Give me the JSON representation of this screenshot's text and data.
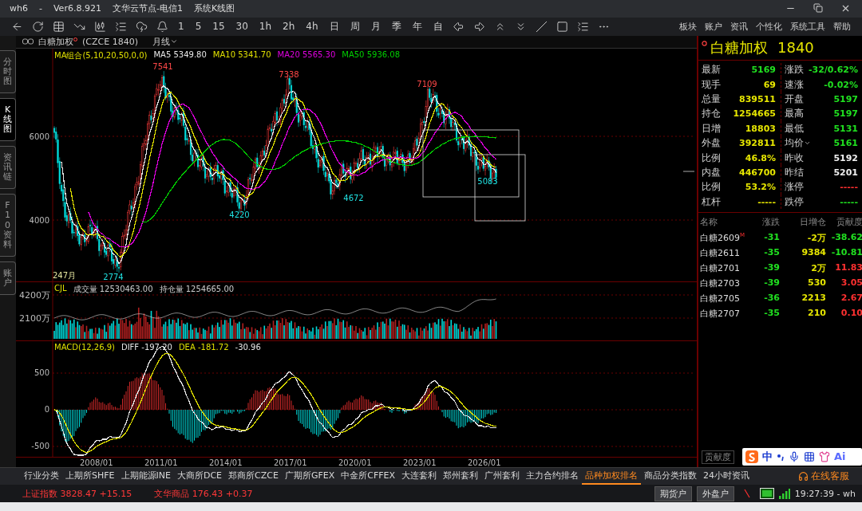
{
  "title_bar": {
    "items": [
      "wh6",
      "-",
      "Ver6.8.921",
      "文华云节点-电信1",
      "系统K线图"
    ]
  },
  "toolbar": {
    "periods": [
      "1",
      "5",
      "15",
      "30",
      "1h",
      "2h",
      "4h",
      "日",
      "周",
      "月",
      "季",
      "年",
      "自"
    ],
    "menus": [
      "板块",
      "账户",
      "资讯",
      "个性化",
      "系统工具",
      "帮助"
    ]
  },
  "side_tabs": [
    {
      "label": "分时图",
      "selected": false
    },
    {
      "label": "K线图",
      "selected": true
    },
    {
      "label": "资讯链",
      "selected": false
    },
    {
      "label": "F10资料",
      "selected": false
    },
    {
      "label": "账户",
      "selected": false
    }
  ],
  "chart": {
    "symbol": "白糖加权",
    "code": "(CZCE 1840)",
    "period": "月线",
    "ma_legend": "MA组合(5,10,20,50,0,0)",
    "ma": [
      {
        "label": "MA5 5349.80",
        "color": "#e8e8e8"
      },
      {
        "label": "MA10 5341.70",
        "color": "#e0e000"
      },
      {
        "label": "MA20 5565.30",
        "color": "#e000e0"
      },
      {
        "label": "MA50 5936.08",
        "color": "#00d000"
      }
    ],
    "price_axis": [
      "6000",
      "4000"
    ],
    "extremes": [
      {
        "text": "7541",
        "kind": "high"
      },
      {
        "text": "7338",
        "kind": "high"
      },
      {
        "text": "7109",
        "kind": "high"
      },
      {
        "text": "4220",
        "kind": "low"
      },
      {
        "text": "4672",
        "kind": "low"
      },
      {
        "text": "5083",
        "kind": "low"
      },
      {
        "text": "2774",
        "kind": "low"
      }
    ],
    "bar_count": "247月",
    "volume": {
      "name": "CJL",
      "items": [
        "成交量 12530463.00",
        "持仓量 1254665.00"
      ],
      "axis": [
        "4200万",
        "2100万"
      ]
    },
    "macd": {
      "name": "MACD(12,26,9)",
      "items": [
        {
          "text": "DIFF -197.20",
          "color": "#e8e8e8"
        },
        {
          "text": "DEA -181.72",
          "color": "#e0e000"
        },
        {
          "text": "-30.96",
          "color": "#e8e8e8"
        }
      ],
      "axis": [
        "500",
        "0",
        "-500"
      ]
    },
    "dates": [
      "2008/01",
      "2011/01",
      "2014/01",
      "2017/01",
      "2020/01",
      "2023/01",
      "2026/01"
    ]
  },
  "quote": {
    "name": "白糖加权",
    "code": "1840",
    "fields": [
      {
        "label": "最新",
        "value": "5169",
        "color": "#20e020",
        "menu": false
      },
      {
        "label": "涨跌",
        "value": "-32/0.62%",
        "color": "#20e020",
        "menu": false
      },
      {
        "label": "现手",
        "value": "69",
        "color": "#e6e600",
        "menu": false
      },
      {
        "label": "速涨",
        "value": "-0.02%",
        "color": "#20e020",
        "menu": false
      },
      {
        "label": "总量",
        "value": "839511",
        "color": "#e6e600",
        "menu": false
      },
      {
        "label": "开盘",
        "value": "5197",
        "color": "#20e020",
        "menu": false
      },
      {
        "label": "持仓",
        "value": "1254665",
        "color": "#e6e600",
        "menu": false
      },
      {
        "label": "最高",
        "value": "5197",
        "color": "#20e020",
        "menu": false
      },
      {
        "label": "日增",
        "value": "18803",
        "color": "#e6e600",
        "menu": false
      },
      {
        "label": "最低",
        "value": "5131",
        "color": "#20e020",
        "menu": false
      },
      {
        "label": "外盘",
        "value": "392811",
        "color": "#e6e600",
        "menu": false
      },
      {
        "label": "均价",
        "value": "5161",
        "color": "#20e020",
        "menu": true
      },
      {
        "label": "比例",
        "value": "46.8%",
        "color": "#e6e600",
        "menu": false
      },
      {
        "label": "昨收",
        "value": "5192",
        "color": "#f0f0f0",
        "menu": false
      },
      {
        "label": "内盘",
        "value": "446700",
        "color": "#e6e600",
        "menu": false
      },
      {
        "label": "昨结",
        "value": "5201",
        "color": "#f0f0f0",
        "menu": false
      },
      {
        "label": "比例",
        "value": "53.2%",
        "color": "#e6e600",
        "menu": false
      },
      {
        "label": "涨停",
        "value": "-----",
        "color": "#ff3030",
        "menu": false
      },
      {
        "label": "杠杆",
        "value": "-----",
        "color": "#e6e600",
        "menu": false
      },
      {
        "label": "跌停",
        "value": "-----",
        "color": "#20e020",
        "menu": false
      }
    ]
  },
  "contracts": {
    "columns": [
      "名称",
      "涨跌",
      "日增仓",
      "贡献度"
    ],
    "rows": [
      {
        "name": "白糖2609",
        "flag": "M",
        "change": "-31",
        "oi": "-2万",
        "contribution": "-38.62",
        "color": "#20e020"
      },
      {
        "name": "白糖2611",
        "change": "-35",
        "oi": "9384",
        "contribution": "-10.81",
        "color": "#20e020"
      },
      {
        "name": "白糖2701",
        "change": "-39",
        "oi": "2万",
        "contribution": "11.83",
        "color": "#ff3030"
      },
      {
        "name": "白糖2703",
        "change": "-39",
        "oi": "530",
        "contribution": "3.05",
        "color": "#ff3030"
      },
      {
        "name": "白糖2705",
        "change": "-36",
        "oi": "2213",
        "contribution": "2.67",
        "color": "#ff3030"
      },
      {
        "name": "白糖2707",
        "change": "-35",
        "oi": "210",
        "contribution": "0.10",
        "color": "#ff3030"
      }
    ],
    "tab": "贡献度"
  },
  "ime": {
    "items": [
      "中",
      "Ai"
    ]
  },
  "bottom_tabs": [
    {
      "label": "行业分类",
      "selected": false
    },
    {
      "label": "上期所SHFE",
      "selected": false
    },
    {
      "label": "上期能源INE",
      "selected": false
    },
    {
      "label": "大商所DCE",
      "selected": false
    },
    {
      "label": "郑商所CZCE",
      "selected": false
    },
    {
      "label": "广期所GFEX",
      "selected": false
    },
    {
      "label": "中金所CFFEX",
      "selected": false
    },
    {
      "label": "大连套利",
      "selected": false
    },
    {
      "label": "郑州套利",
      "selected": false
    },
    {
      "label": "广州套利",
      "selected": false
    },
    {
      "label": "主力合约排名",
      "selected": false
    },
    {
      "label": "品种加权排名",
      "selected": true
    },
    {
      "label": "商品分类指数",
      "selected": false
    },
    {
      "label": "24小时资讯",
      "selected": false
    }
  ],
  "service": "在线客服",
  "status_bar": {
    "indices": [
      {
        "name": "上证指数",
        "value": "3828.47",
        "change": "+15.15"
      },
      {
        "name": "文华商品",
        "value": "176.43",
        "change": "+0.37"
      }
    ],
    "buttons": [
      "期货户",
      "外盘户"
    ],
    "clock": "19:27:39 - wh"
  }
}
